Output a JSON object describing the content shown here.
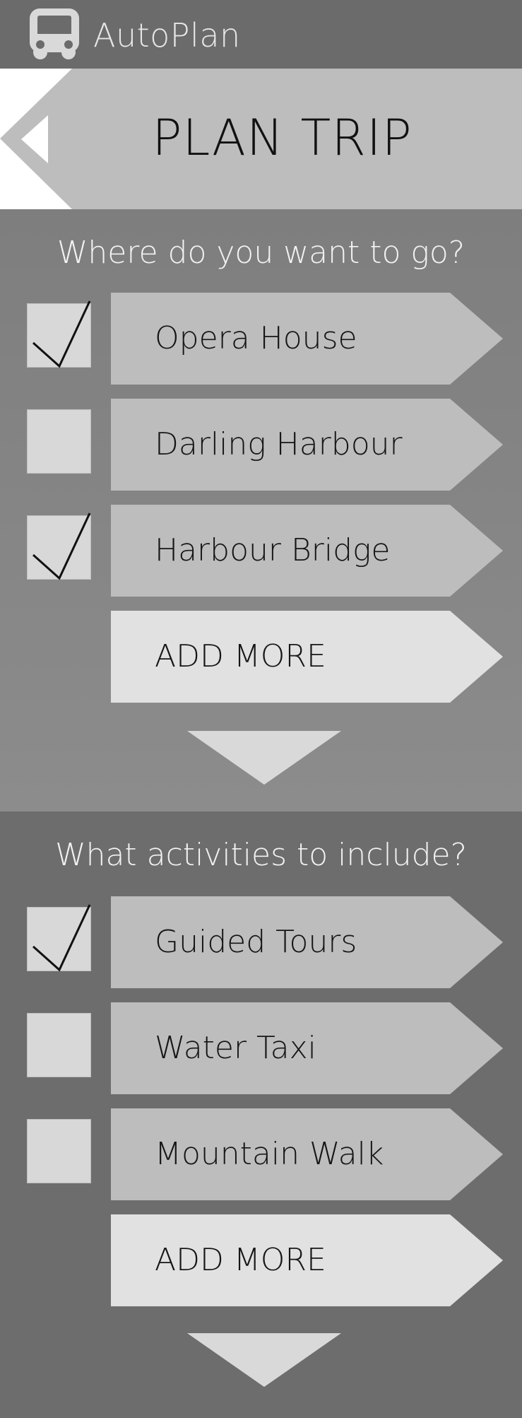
{
  "app": {
    "name": "AutoPlan",
    "logo_icon": "bus-icon"
  },
  "header": {
    "title": "PLAN TRIP",
    "back_icon": "back-arrow-icon"
  },
  "destinations": {
    "question": "Where do you want to go?",
    "items": [
      {
        "label": "Opera House",
        "checked": true
      },
      {
        "label": "Darling Harbour",
        "checked": false
      },
      {
        "label": "Harbour Bridge",
        "checked": true
      }
    ],
    "add_more_label": "ADD MORE",
    "expand_icon": "chevron-down-icon"
  },
  "activities": {
    "question": "What activities to include?",
    "items": [
      {
        "label": "Guided Tours",
        "checked": true
      },
      {
        "label": "Water Taxi",
        "checked": false
      },
      {
        "label": "Mountain Walk",
        "checked": false
      }
    ],
    "add_more_label": "ADD MORE",
    "expand_icon": "chevron-down-icon"
  },
  "colors": {
    "topbar": "#6b6b6b",
    "header": "#bdbdbd",
    "option_button": "#bdbdbd",
    "add_more_button": "#e1e1e1",
    "checkbox": "#d8d8d8"
  }
}
